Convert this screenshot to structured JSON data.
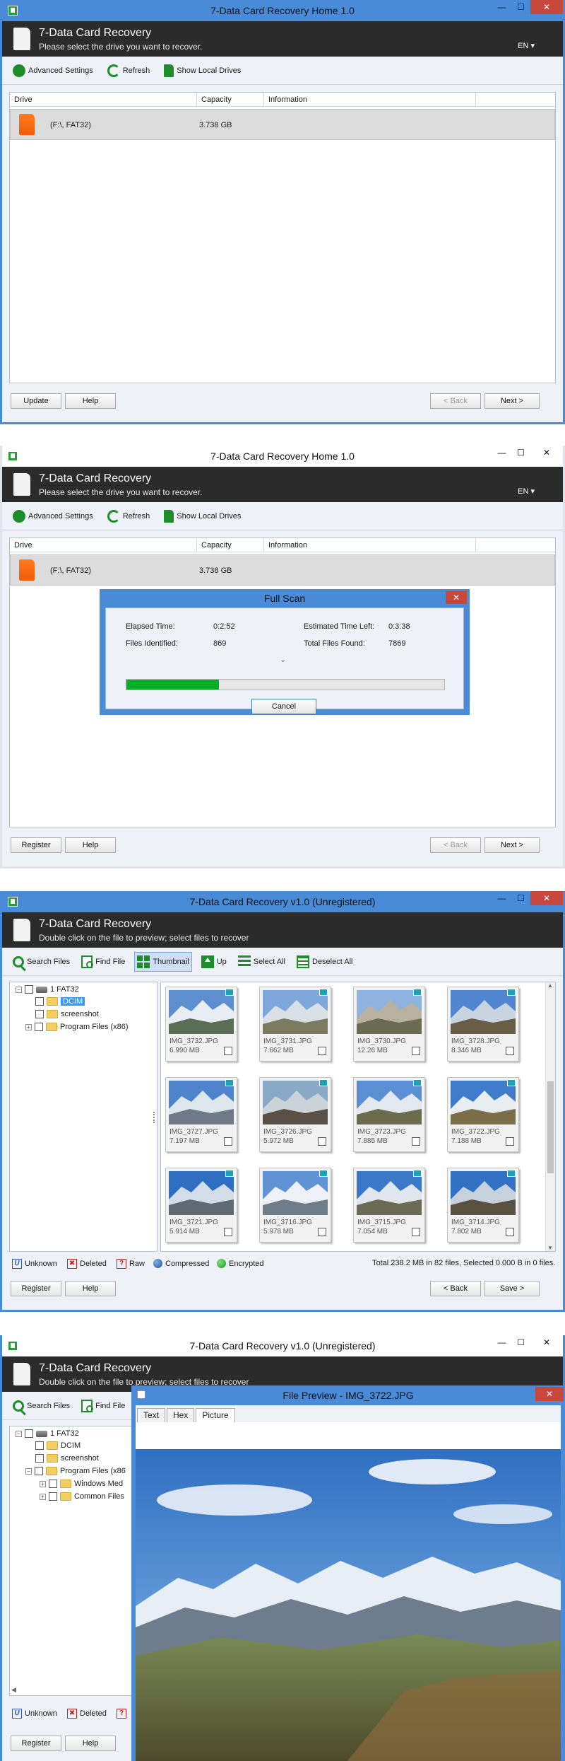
{
  "win1": {
    "title": "7-Data Card Recovery Home 1.0",
    "header_title": "7-Data Card Recovery",
    "header_subtitle": "Please select the drive you want to recover.",
    "lang": "EN ▾",
    "toolbar": {
      "advanced": "Advanced Settings",
      "refresh": "Refresh",
      "local": "Show Local Drives"
    },
    "columns": {
      "drive": "Drive",
      "capacity": "Capacity",
      "info": "Information"
    },
    "drive": {
      "name": "(F:\\, FAT32)",
      "capacity": "3.738 GB"
    },
    "buttons": {
      "left1": "Update",
      "help": "Help",
      "back": "< Back",
      "next": "Next >"
    }
  },
  "win2": {
    "title": "7-Data Card Recovery Home 1.0",
    "header_title": "7-Data Card Recovery",
    "header_subtitle": "Please select the drive you want to recover.",
    "lang": "EN ▾",
    "toolbar": {
      "advanced": "Advanced Settings",
      "refresh": "Refresh",
      "local": "Show Local Drives"
    },
    "columns": {
      "drive": "Drive",
      "capacity": "Capacity",
      "info": "Information"
    },
    "drive": {
      "name": "(F:\\, FAT32)",
      "capacity": "3.738 GB"
    },
    "scan": {
      "title": "Full Scan",
      "elapsed_label": "Elapsed Time:",
      "elapsed": "0:2:52",
      "left_label": "Estimated Time Left:",
      "left": "0:3:38",
      "identified_label": "Files Identified:",
      "identified": "869",
      "found_label": "Total Files Found:",
      "found": "7869",
      "progress": 0.29,
      "cancel": "Cancel"
    },
    "buttons": {
      "left1": "Register",
      "help": "Help",
      "back": "< Back",
      "next": "Next >"
    }
  },
  "win3": {
    "title": "7-Data Card Recovery v1.0 (Unregistered)",
    "header_title": "7-Data Card Recovery",
    "header_subtitle": "Double click on the file to preview; select files to recover",
    "toolbar": {
      "search": "Search Files",
      "find": "Find File",
      "thumb": "Thumbnail",
      "up": "Up",
      "selall": "Select All",
      "desel": "Deselect All"
    },
    "tree": {
      "root": "1 FAT32",
      "dcim": "DCIM",
      "screenshot": "screenshot",
      "pf": "Program Files (x86)"
    },
    "thumbs": [
      {
        "name": "IMG_3732.JPG",
        "size": "6.990 MB"
      },
      {
        "name": "IMG_3731.JPG",
        "size": "7.662 MB"
      },
      {
        "name": "IMG_3730.JPG",
        "size": "12.26 MB"
      },
      {
        "name": "IMG_3728.JPG",
        "size": "8.346 MB"
      },
      {
        "name": "IMG_3727.JPG",
        "size": "7.197 MB"
      },
      {
        "name": "IMG_3726.JPG",
        "size": "5.972 MB"
      },
      {
        "name": "IMG_3723.JPG",
        "size": "7.885 MB"
      },
      {
        "name": "IMG_3722.JPG",
        "size": "7.188 MB"
      },
      {
        "name": "IMG_3721.JPG",
        "size": "5.914 MB"
      },
      {
        "name": "IMG_3716.JPG",
        "size": "5.978 MB"
      },
      {
        "name": "IMG_3715.JPG",
        "size": "7.054 MB"
      },
      {
        "name": "IMG_3714.JPG",
        "size": "7.802 MB"
      }
    ],
    "legend": {
      "unknown": "Unknown",
      "deleted": "Deleted",
      "raw": "Raw",
      "compressed": "Compressed",
      "encrypted": "Encrypted"
    },
    "status": "Total 238.2 MB in 82 files, Selected 0.000 B in 0 files.",
    "buttons": {
      "left1": "Register",
      "help": "Help",
      "back": "< Back",
      "save": "Save >"
    }
  },
  "win4": {
    "title": "7-Data Card Recovery v1.0 (Unregistered)",
    "header_title": "7-Data Card Recovery",
    "header_subtitle": "Double click on the file to preview; select files to recover",
    "toolbar": {
      "search": "Search Files",
      "find": "Find File"
    },
    "tree": {
      "root": "1 FAT32",
      "dcim": "DCIM",
      "screenshot": "screenshot",
      "pf": "Program Files (x86",
      "wm": "Windows Med",
      "cf": "Common Files"
    },
    "legend": {
      "unknown": "Unknown",
      "deleted": "Deleted"
    },
    "buttons": {
      "left1": "Register",
      "help": "Help"
    },
    "preview": {
      "title": "File Preview - IMG_3722.JPG",
      "tabs": [
        "Text",
        "Hex",
        "Picture"
      ]
    }
  }
}
